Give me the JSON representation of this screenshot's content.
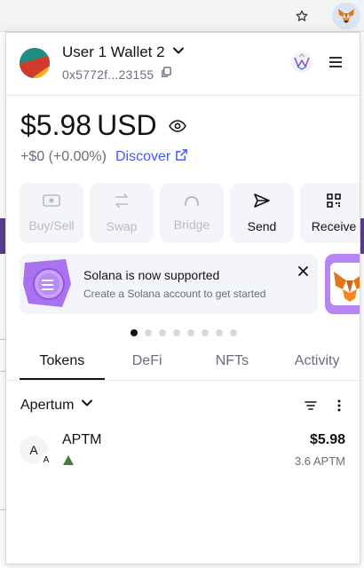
{
  "browser": {
    "bookmark_icon": "star-icon",
    "extension_icon": "metamask-fox-icon"
  },
  "header": {
    "account_name": "User 1 Wallet 2",
    "account_address": "0x5772f...23155"
  },
  "balance": {
    "amount": "$5.98",
    "currency": "USD",
    "change": "+$0 (+0.00%)",
    "discover_label": "Discover"
  },
  "actions": [
    {
      "label": "Buy/Sell",
      "enabled": false
    },
    {
      "label": "Swap",
      "enabled": false
    },
    {
      "label": "Bridge",
      "enabled": false
    },
    {
      "label": "Send",
      "enabled": true
    },
    {
      "label": "Receive",
      "enabled": true
    }
  ],
  "banner": {
    "title": "Solana is now supported",
    "description": "Create a Solana account to get started"
  },
  "carousel": {
    "total": 8,
    "active_index": 0
  },
  "tabs": [
    "Tokens",
    "DeFi",
    "NFTs",
    "Activity"
  ],
  "active_tab": "Tokens",
  "network_filter": {
    "label": "Apertum"
  },
  "tokens": [
    {
      "avatar_letter": "A",
      "badge_letter": "A",
      "name": "APTM",
      "fiat_value": "$5.98",
      "quantity": "3.6 APTM"
    }
  ],
  "colors": {
    "accent": "#4459ff",
    "text": "#121314",
    "muted": "#686e7d",
    "button_bg": "#f3f5f9",
    "positive": "#457a39"
  }
}
